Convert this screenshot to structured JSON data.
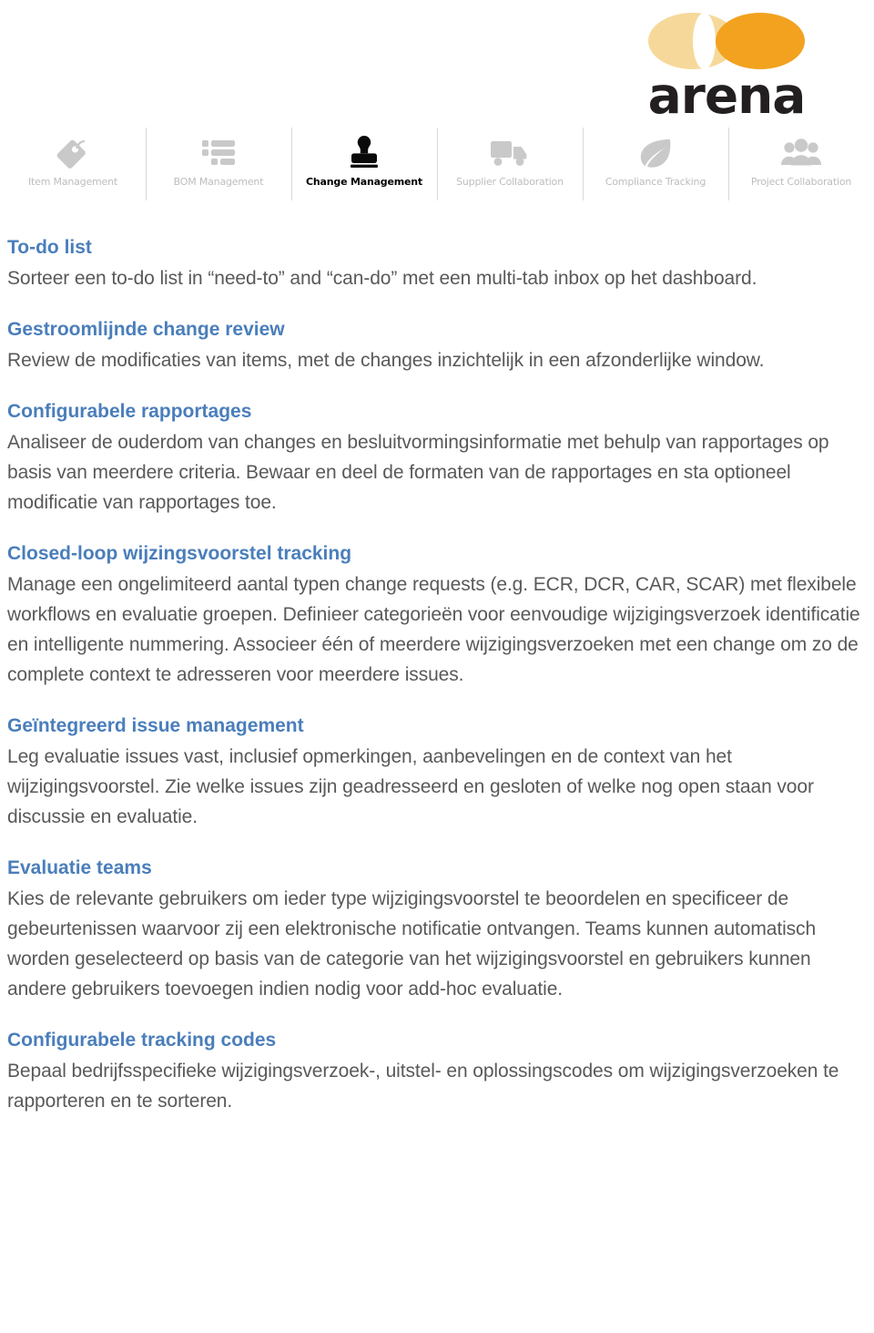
{
  "brand": {
    "logo_text": "arena",
    "logo_colors": {
      "left_ellipse": "#f6d99a",
      "right_ellipse": "#f2a21f",
      "wordmark": "#231f20"
    }
  },
  "nav": {
    "items": [
      {
        "label": "Item Management",
        "icon": "tag-icon",
        "active": false
      },
      {
        "label": "BOM Management",
        "icon": "list-icon",
        "active": false
      },
      {
        "label": "Change Management",
        "icon": "stamp-icon",
        "active": true
      },
      {
        "label": "Supplier Collaboration",
        "icon": "truck-icon",
        "active": false
      },
      {
        "label": "Compliance Tracking",
        "icon": "leaf-icon",
        "active": false
      },
      {
        "label": "Project Collaboration",
        "icon": "people-icon",
        "active": false
      }
    ],
    "inactive_color": "#bdbdbd",
    "active_color": "#000000",
    "divider_color": "#d9d9d9"
  },
  "content": {
    "heading_color": "#4a7ebb",
    "body_color": "#595959",
    "sections": [
      {
        "heading": "To-do list",
        "body": "Sorteer een to-do list in “need-to” and “can-do” met een multi-tab inbox op het dashboard."
      },
      {
        "heading": "Gestroomlijnde change review",
        "body": "Review de modificaties van items, met de changes inzichtelijk in een afzonderlijke window."
      },
      {
        "heading": "Configurabele rapportages",
        "body": "Analiseer de ouderdom van changes en besluitvormingsinformatie met behulp van rapportages op basis van meerdere criteria. Bewaar en deel de formaten van de rapportages en sta optioneel modificatie van rapportages toe."
      },
      {
        "heading": "Closed-loop wijzingsvoorstel tracking",
        "body": "Manage een ongelimiteerd aantal typen change requests (e.g. ECR, DCR, CAR, SCAR) met flexibele workflows en evaluatie groepen. Definieer categorieën voor eenvoudige wijzigingsverzoek identificatie en intelligente nummering. Associeer één of meerdere wijzigingsverzoeken met een change om zo de complete context te adresseren voor meerdere issues."
      },
      {
        "heading": "Geïntegreerd issue management",
        "body": "Leg evaluatie issues vast, inclusief opmerkingen, aanbevelingen en de context van het wijzigingsvoorstel. Zie welke issues zijn geadresseerd en gesloten of welke nog open staan voor discussie en evaluatie."
      },
      {
        "heading": "Evaluatie teams",
        "body": "Kies de relevante gebruikers om ieder type wijzigingsvoorstel te beoordelen en specificeer de gebeurtenissen waarvoor zij een elektronische notificatie ontvangen. Teams kunnen automatisch worden geselecteerd op basis van de categorie van het wijzigingsvoorstel en gebruikers kunnen andere gebruikers toevoegen indien nodig voor add-hoc evaluatie."
      },
      {
        "heading": "Configurabele tracking codes",
        "body": "Bepaal bedrijfsspecifieke wijzigingsverzoek-, uitstel- en oplossingscodes om wijzigingsverzoeken te rapporteren en te sorteren."
      }
    ]
  }
}
